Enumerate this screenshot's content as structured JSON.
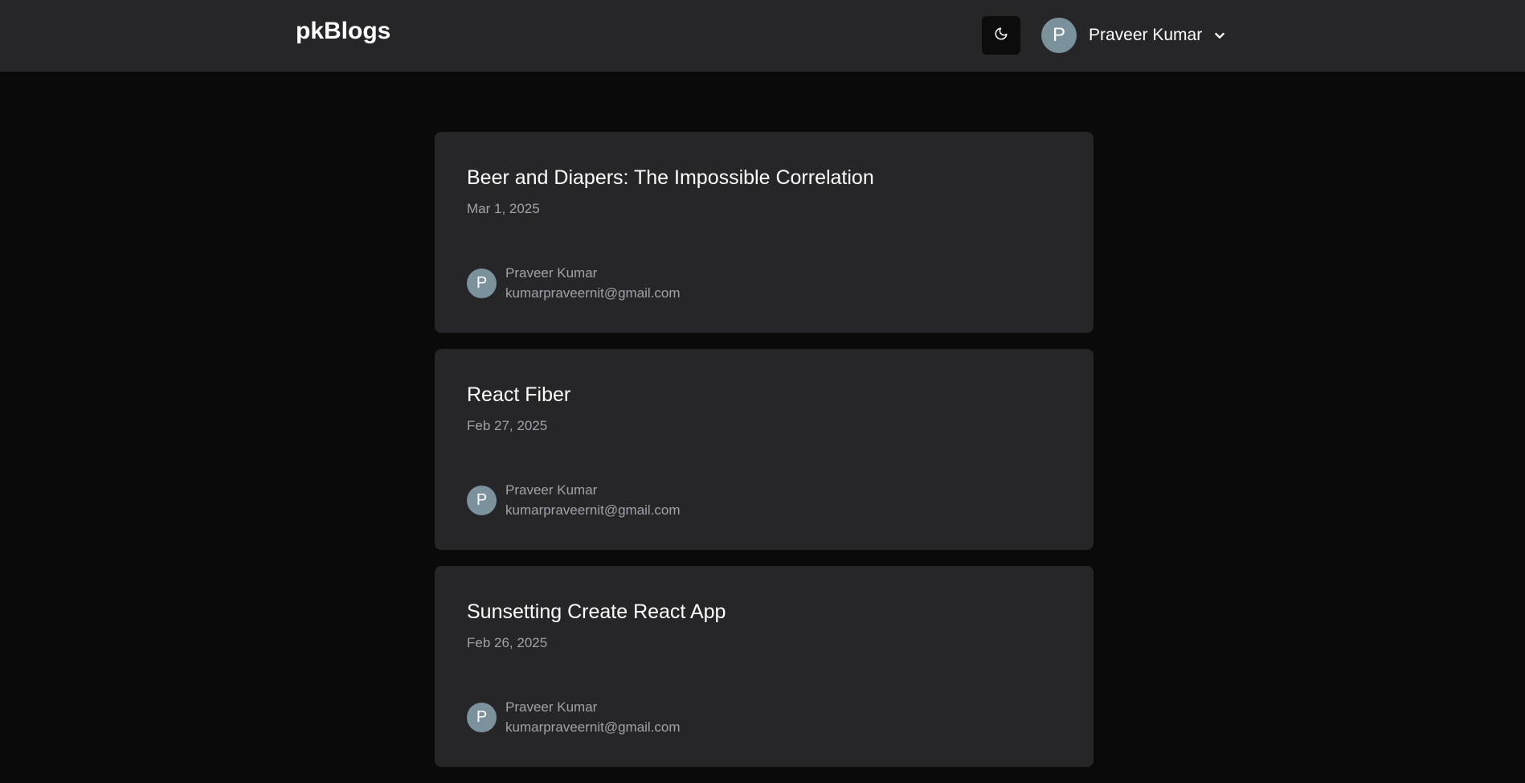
{
  "navbar": {
    "brand": "pkBlogs",
    "theme_toggle_icon": "moon-icon",
    "user": {
      "initial": "P",
      "name": "Praveer Kumar",
      "menu_icon": "chevron-down-icon"
    }
  },
  "posts": [
    {
      "title": "Beer and Diapers: The Impossible Correlation",
      "date": "Mar 1, 2025",
      "author": {
        "initial": "P",
        "name": "Praveer Kumar",
        "email": "kumarpraveernit@gmail.com"
      }
    },
    {
      "title": "React Fiber",
      "date": "Feb 27, 2025",
      "author": {
        "initial": "P",
        "name": "Praveer Kumar",
        "email": "kumarpraveernit@gmail.com"
      }
    },
    {
      "title": "Sunsetting Create React App",
      "date": "Feb 26, 2025",
      "author": {
        "initial": "P",
        "name": "Praveer Kumar",
        "email": "kumarpraveernit@gmail.com"
      }
    }
  ],
  "colors": {
    "background": "#0a0a0b",
    "surface": "#262628",
    "avatar": "#7b919c",
    "muted_text": "#a1a1a8"
  }
}
